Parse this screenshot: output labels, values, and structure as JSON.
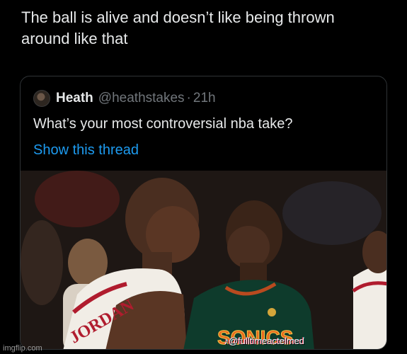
{
  "caption": {
    "line1": "The ball is alive and doesn’t like being thrown",
    "line2": "around like that"
  },
  "quoted_tweet": {
    "name": "Heath",
    "handle": "@heathstakes",
    "separator": "·",
    "time": "21h",
    "text": "What’s your most controversial nba take?",
    "show_thread": "Show this thread",
    "avatar_icon": "user-avatar",
    "link_color": "#1d9bf0"
  },
  "photo": {
    "jersey_left": "JORDAN",
    "jersey_right": "SONICS",
    "watermark": "@fulltimeactelmed",
    "watermark_icon": "tiktok-icon"
  },
  "footer": {
    "credit": "imgflip.com"
  }
}
